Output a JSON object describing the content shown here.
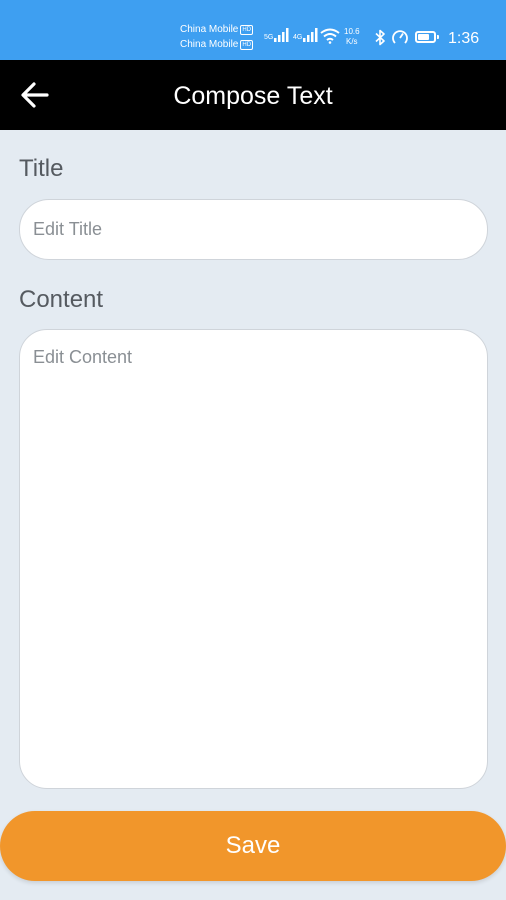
{
  "status_bar": {
    "carrier_1": "China Mobile",
    "carrier_2": "China Mobile",
    "hd_badge": "HD",
    "net_1": "5G",
    "net_2": "4G",
    "speed_value": "10.6",
    "speed_unit": "K/s",
    "time": "1:36",
    "battery_level": 0.75,
    "background_color": "#3e9ff1"
  },
  "app_bar": {
    "back_icon": "arrow-left-icon",
    "title": "Compose Text",
    "background_color": "#000000"
  },
  "form": {
    "title_label": "Title",
    "title_placeholder": "Edit Title",
    "title_value": "",
    "content_label": "Content",
    "content_placeholder": "Edit Content",
    "content_value": ""
  },
  "actions": {
    "save_label": "Save",
    "save_color": "#f1962b"
  }
}
